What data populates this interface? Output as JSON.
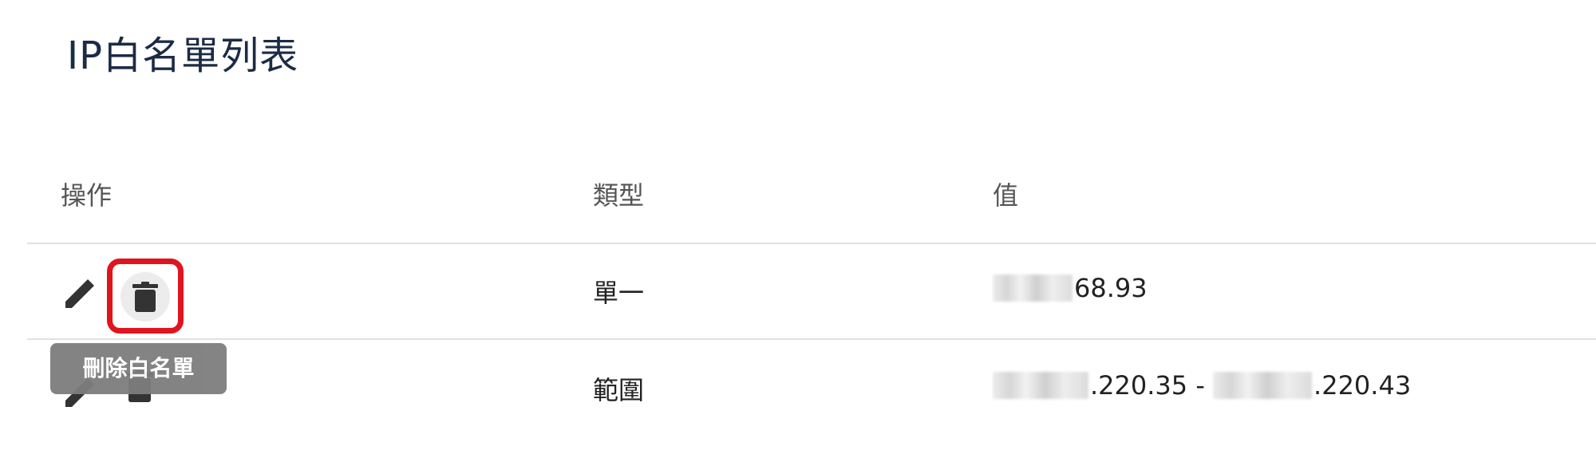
{
  "page": {
    "title": "IP白名單列表"
  },
  "table": {
    "columns": [
      "操作",
      "類型",
      "值"
    ],
    "rows": [
      {
        "type": "單一",
        "value": "68.93"
      },
      {
        "type": "範圍",
        "value_start": ".220.35",
        "separator": " - ",
        "value_end": ".220.43"
      }
    ]
  },
  "actions": {
    "edit_icon": "pencil-icon",
    "delete_icon": "trash-icon",
    "delete_tooltip": "刪除白名單"
  },
  "colors": {
    "title": "#1c2b45",
    "highlight_border": "#e0141e",
    "tooltip_bg": "#7d7d7d",
    "icon": "#333333"
  }
}
